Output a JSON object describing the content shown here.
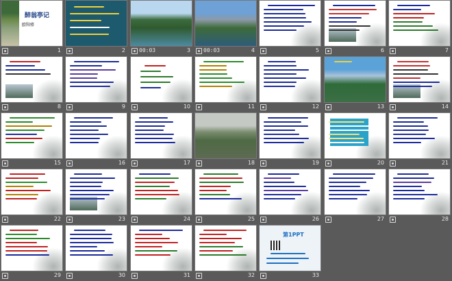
{
  "slides": [
    {
      "n": "1",
      "t": "",
      "style": "title"
    },
    {
      "n": "2",
      "t": "",
      "style": "yellowtext"
    },
    {
      "n": "3",
      "t": "00:03",
      "style": "photo-lake"
    },
    {
      "n": "4",
      "t": "00:03",
      "style": "photo-mountain"
    },
    {
      "n": "5",
      "t": "",
      "style": "text-scroll"
    },
    {
      "n": "6",
      "t": "",
      "style": "text-ink"
    },
    {
      "n": "7",
      "t": "",
      "style": "text-red"
    },
    {
      "n": "8",
      "t": "",
      "style": "text-photo"
    },
    {
      "n": "9",
      "t": "",
      "style": "text-blue"
    },
    {
      "n": "10",
      "t": "",
      "style": "text-center"
    },
    {
      "n": "11",
      "t": "",
      "style": "text-colored"
    },
    {
      "n": "12",
      "t": "",
      "style": "text-scroll"
    },
    {
      "n": "13",
      "t": "",
      "style": "photo-forest"
    },
    {
      "n": "14",
      "t": "",
      "style": "text-ink"
    },
    {
      "n": "15",
      "t": "",
      "style": "text-colored"
    },
    {
      "n": "16",
      "t": "",
      "style": "text-scroll"
    },
    {
      "n": "17",
      "t": "",
      "style": "text-scroll"
    },
    {
      "n": "18",
      "t": "",
      "style": "photo-peaks"
    },
    {
      "n": "19",
      "t": "",
      "style": "text-scroll"
    },
    {
      "n": "20",
      "t": "",
      "style": "text-box"
    },
    {
      "n": "21",
      "t": "",
      "style": "text-scroll"
    },
    {
      "n": "22",
      "t": "",
      "style": "text-colored"
    },
    {
      "n": "23",
      "t": "",
      "style": "text-lake"
    },
    {
      "n": "24",
      "t": "",
      "style": "text-red"
    },
    {
      "n": "25",
      "t": "",
      "style": "text-red"
    },
    {
      "n": "26",
      "t": "",
      "style": "text-blue"
    },
    {
      "n": "27",
      "t": "",
      "style": "text-scroll"
    },
    {
      "n": "28",
      "t": "",
      "style": "text-blue"
    },
    {
      "n": "29",
      "t": "",
      "style": "text-colored"
    },
    {
      "n": "30",
      "t": "",
      "style": "text-scroll"
    },
    {
      "n": "31",
      "t": "",
      "style": "text-red"
    },
    {
      "n": "32",
      "t": "",
      "style": "text-red"
    },
    {
      "n": "33",
      "t": "",
      "style": "ad"
    }
  ],
  "ad": {
    "brand": "第1PPT"
  },
  "title_slide": {
    "line1": "醉翁亭记",
    "line2": "欧阳修"
  }
}
